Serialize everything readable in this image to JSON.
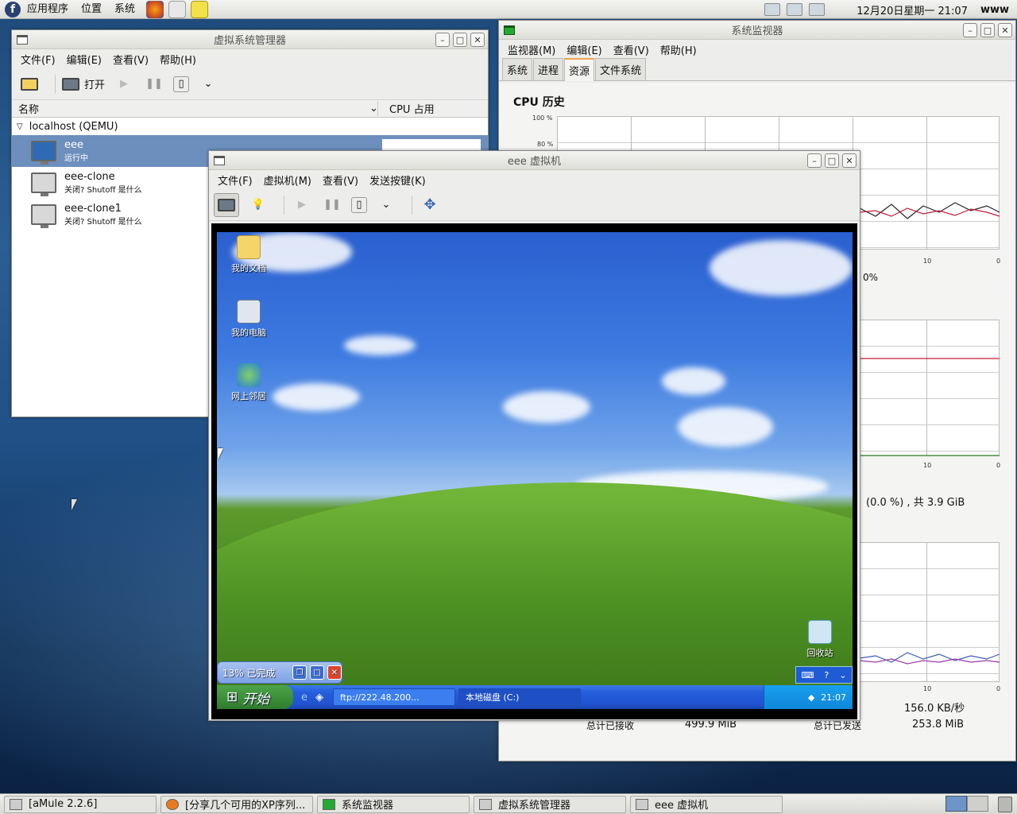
{
  "top_panel": {
    "menus": [
      "应用程序",
      "位置",
      "系统"
    ],
    "launchers": [
      "firefox-icon",
      "mail-icon",
      "notes-icon"
    ],
    "clock": "12月20日星期一 21:07",
    "user": "www"
  },
  "vm_manager": {
    "title": "虚拟系统管理器",
    "menus": [
      "文件(F)",
      "编辑(E)",
      "查看(V)",
      "帮助(H)"
    ],
    "open_label": "打开",
    "columns": {
      "name": "名称",
      "cpu": "CPU 占用"
    },
    "host": "localhost (QEMU)",
    "vms": [
      {
        "name": "eee",
        "status": "运行中"
      },
      {
        "name": "eee-clone",
        "status": "关闭? Shutoff 是什么"
      },
      {
        "name": "eee-clone1",
        "status": "关闭? Shutoff 是什么"
      }
    ]
  },
  "sys_monitor": {
    "title": "系统监视器",
    "menus": [
      "监视器(M)",
      "编辑(E)",
      "查看(V)",
      "帮助(H)"
    ],
    "tabs": [
      "系统",
      "进程",
      "资源",
      "文件系统"
    ],
    "cpu_heading": "CPU 历史",
    "y_ticks": [
      "100 %",
      "80 %"
    ],
    "x_ticks": [
      "10",
      "0"
    ],
    "cpu_pct": "0%",
    "mem_text": "(0.0 %) , 共 3.9 GiB",
    "net_rate": "156.0 KB/秒",
    "recv_label": "总计已接收",
    "recv_value": "499.9 MiB",
    "sent_label": "总计已发送",
    "sent_value": "253.8 MiB"
  },
  "vm_viewer": {
    "title": "eee 虚拟机",
    "menus": [
      "文件(F)",
      "虚拟机(M)",
      "查看(V)",
      "发送按键(K)"
    ]
  },
  "guest": {
    "icons": [
      "我的文档",
      "我的电脑",
      "网上邻居",
      "回收站"
    ],
    "start": "开始",
    "progress": "13% 已完成",
    "tasks": [
      "ftp://222.48.200...",
      "本地磁盘 (C:)"
    ],
    "clock": "21:07"
  },
  "taskbar": [
    "[aMule 2.2.6]",
    "[分享几个可用的XP序列...",
    "系统监视器",
    "虚拟系统管理器",
    "eee 虚拟机"
  ]
}
